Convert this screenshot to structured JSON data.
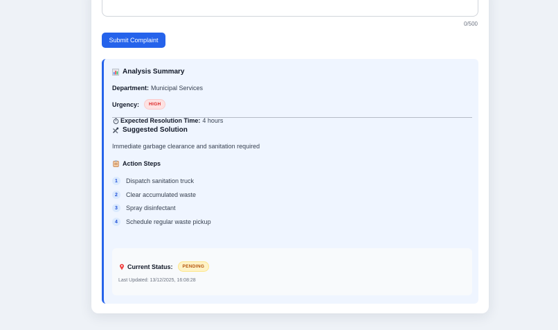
{
  "form": {
    "char_count": "0/500",
    "submit_label": "Submit Complaint"
  },
  "analysis": {
    "title": "Analysis Summary",
    "title_icon": "bar-chart-icon",
    "department_label": "Department:",
    "department_value": "Municipal Services",
    "urgency_label": "Urgency:",
    "urgency_value": "HIGH",
    "resolution_icon": "stopwatch-icon",
    "resolution_label": "Expected Resolution Time:",
    "resolution_value": "4 hours",
    "solution_title": "Suggested Solution",
    "solution_icon": "tools-icon",
    "solution_text": "Immediate garbage clearance and sanitation required",
    "steps_title": "Action Steps",
    "steps_icon": "clipboard-icon",
    "steps": [
      {
        "num": "1",
        "text": "Dispatch sanitation truck"
      },
      {
        "num": "2",
        "text": "Clear accumulated waste"
      },
      {
        "num": "3",
        "text": "Spray disinfectant"
      },
      {
        "num": "4",
        "text": "Schedule regular waste pickup"
      }
    ]
  },
  "status": {
    "icon": "pin-icon",
    "label": "Current Status:",
    "value": "PENDING",
    "last_updated": "Last Updated: 13/12/2025, 16:08:28"
  },
  "colors": {
    "accent": "#2563eb",
    "high": "#dc2626",
    "pending": "#b45309"
  }
}
